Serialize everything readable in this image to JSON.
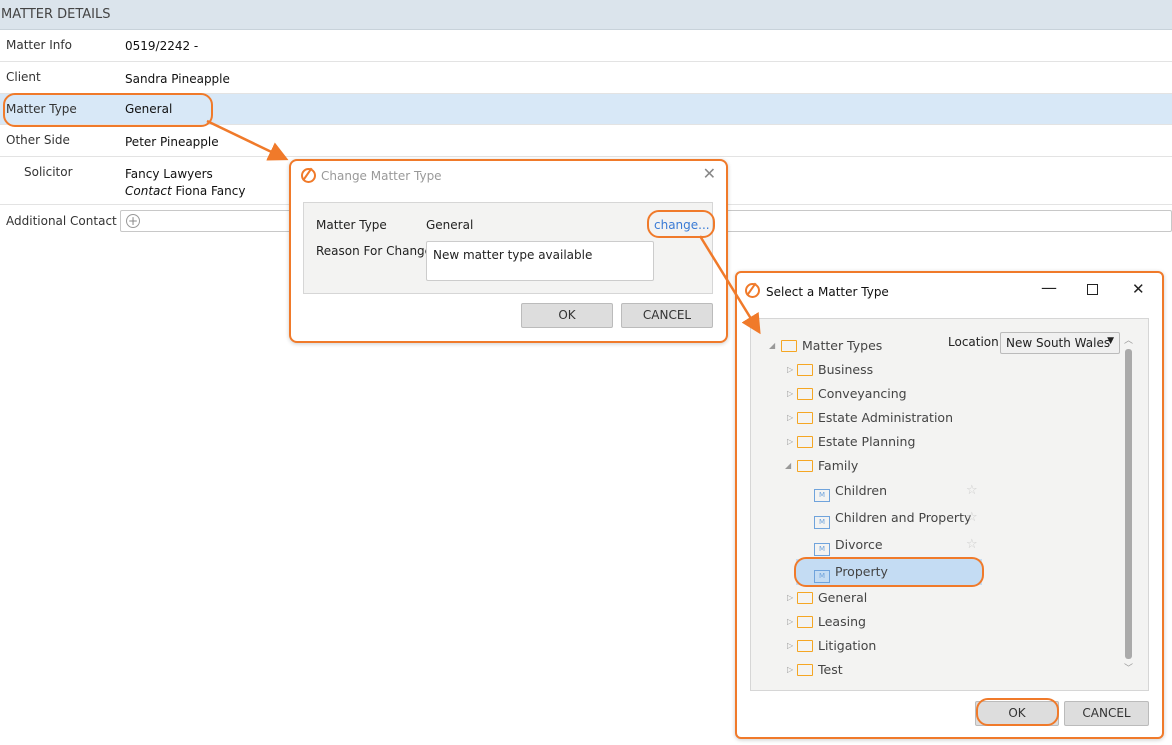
{
  "header": {
    "title": "MATTER DETAILS"
  },
  "rows": [
    {
      "label": "Matter Info",
      "value": "0519/2242 -"
    },
    {
      "label": "Client",
      "value": "Sandra Pineapple"
    },
    {
      "label": "Matter Type",
      "value": "General"
    },
    {
      "label": "Other Side",
      "value": "Peter Pineapple"
    },
    {
      "label": "Solicitor",
      "value": "Fancy Lawyers",
      "contact_label": "Contact",
      "contact_value": "Fiona Fancy"
    },
    {
      "label": "Additional Contact"
    }
  ],
  "change_dialog": {
    "title": "Change Matter Type",
    "matter_type_label": "Matter Type",
    "matter_type_value": "General",
    "change_link": "change...",
    "reason_label": "Reason For Change",
    "reason_value": "New matter type available",
    "ok": "OK",
    "cancel": "CANCEL"
  },
  "select_dialog": {
    "title": "Select a Matter Type",
    "location_label": "Location",
    "location_value": "New South Wales",
    "root": "Matter Types",
    "folders_before": [
      "Business",
      "Conveyancing",
      "Estate Administration",
      "Estate Planning"
    ],
    "family": "Family",
    "family_children": [
      "Children",
      "Children and Property",
      "Divorce",
      "Property"
    ],
    "selected": "Property",
    "folders_after": [
      "General",
      "Leasing",
      "Litigation",
      "Test"
    ],
    "ok": "OK",
    "cancel": "CANCEL"
  },
  "colors": {
    "accent": "#f07a2a",
    "selection": "#d8e8f7",
    "link": "#3a7bd5"
  }
}
